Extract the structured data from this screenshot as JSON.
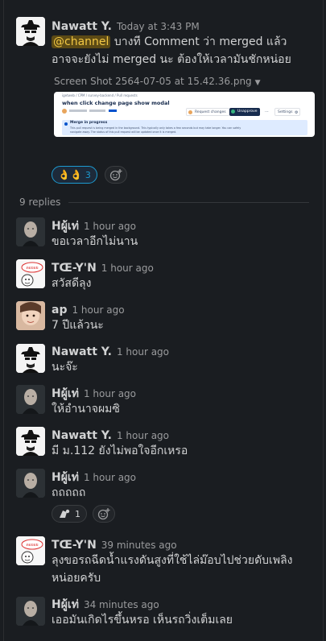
{
  "root": {
    "author": "Nawatt Y.",
    "time": "Today at 3:43 PM",
    "mention": "@channel",
    "text_line1": " บางที Comment ว่า merged แล้ว",
    "text_line2": "อาจจะยังไม่ merged นะ ต้องให้เวลามันชักหน่อย",
    "file_name": "Screen Shot 2564-07-05 at 15.42.36.png",
    "reaction_count": "3"
  },
  "attachment": {
    "breadcrumb": "igetweb / CPM / survey-backend / Pull requests",
    "title": "when click change page show modal",
    "request_changes": "Request changes",
    "unapprove": "Unapprove",
    "settings": "Settings",
    "notice_title": "Merge in progress",
    "notice_line1": "This pull request is being merged in the background. This typically only takes a few seconds but may take longer. You can safely",
    "notice_line2": "navigate away. The status of this pull request will be updated once it is merged."
  },
  "thread": {
    "replies_label": "9 replies",
    "replies": [
      {
        "author": "Hผู้เท่",
        "time": "1 hour ago",
        "text": "ขอเวลาอีกไม่นาน",
        "text2": ""
      },
      {
        "author": "TŒ-Y'N",
        "time": "1 hour ago",
        "text": "สวัสดีลุง",
        "text2": ""
      },
      {
        "author": "ap",
        "time": "1 hour ago",
        "text": "7 ปีแล้วนะ",
        "text2": ""
      },
      {
        "author": "Nawatt Y.",
        "time": "1 hour ago",
        "text": "นะจ๊ะ",
        "text2": ""
      },
      {
        "author": "Hผู้เท่",
        "time": "1 hour ago",
        "text": "ให้อำนาจผมซิ",
        "text2": ""
      },
      {
        "author": "Nawatt Y.",
        "time": "1 hour ago",
        "text": "มี ม.112 ยังไม่พอใจอีกเหรอ",
        "text2": ""
      },
      {
        "author": "Hผู้เท่",
        "time": "1 hour ago",
        "text": "ถถถถถ",
        "text2": "",
        "reaction_count": "1"
      },
      {
        "author": "TŒ-Y'N",
        "time": "39 minutes ago",
        "text": "ลุงขอรถฉีดน้ำแรงดันสูงที่ใช้ไล่ม๊อบไปช่วยดับเพลิง",
        "text2": "หน่อยครับ"
      },
      {
        "author": "Hผู้เท่",
        "time": "34 minutes ago",
        "text": "เออมันเกิดไรขึ้นหรอ เห็นรถวิ่งเต็มเลย",
        "text2": ""
      }
    ]
  },
  "avatar_labels": {
    "toey": "ดอยอย"
  },
  "colors": {
    "background": "#1a1d21",
    "mention_bg": "#5c4a15",
    "mention_fg": "#f2c744",
    "reaction_accent": "#1d9bd1"
  }
}
